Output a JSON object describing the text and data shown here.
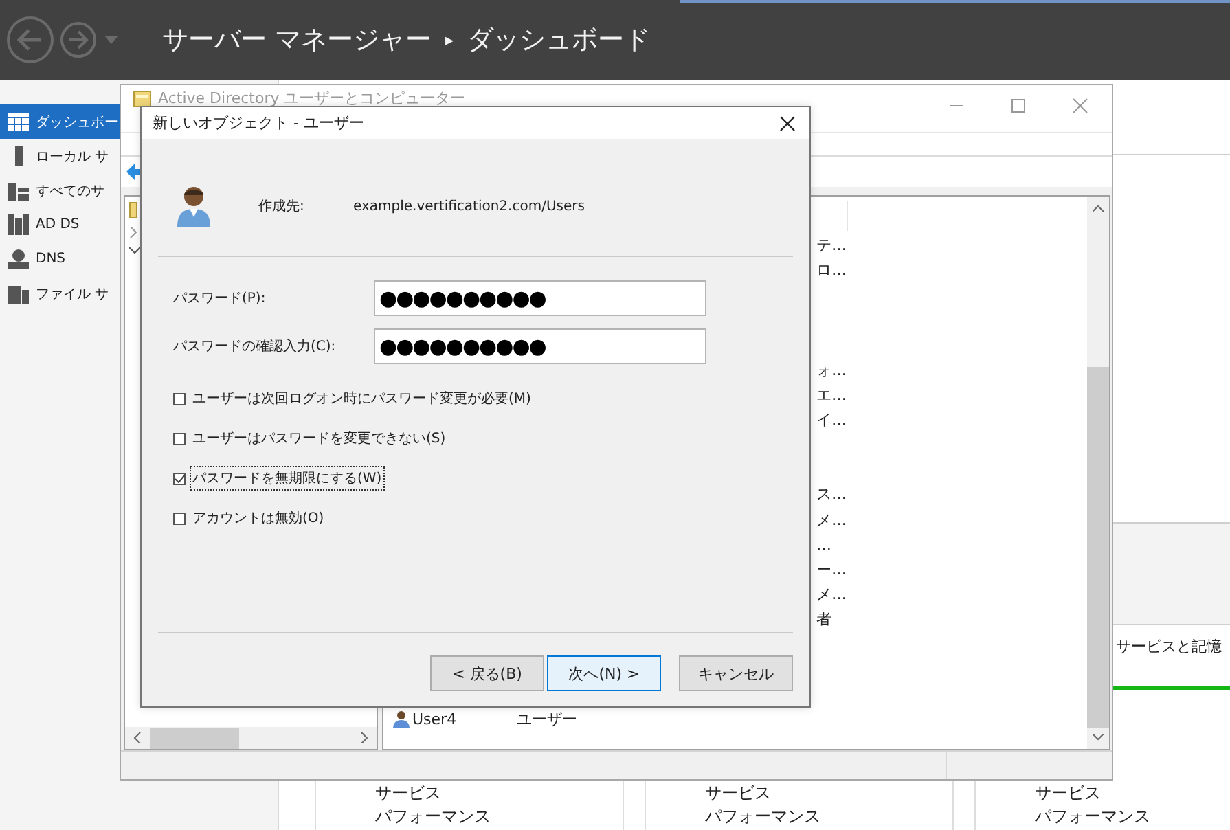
{
  "server_manager": {
    "breadcrumb": {
      "app": "サーバー マネージャー",
      "separator": "▸",
      "page": "ダッシュボード"
    },
    "sidebar": {
      "items": [
        {
          "label": "ダッシュボー",
          "selected": true
        },
        {
          "label": "ローカル サ",
          "selected": false
        },
        {
          "label": "すべてのサ",
          "selected": false
        },
        {
          "label": "AD DS",
          "selected": false
        },
        {
          "label": "DNS",
          "selected": false
        },
        {
          "label": "ファイル サ",
          "selected": false
        }
      ]
    },
    "tile_heading": "サービスと記憶",
    "tiles": [
      {
        "rows": [
          "サービス",
          "パフォーマンス"
        ]
      },
      {
        "rows": [
          "サービス",
          "パフォーマンス"
        ]
      },
      {
        "rows": [
          "サービス",
          "パフォーマンス"
        ]
      }
    ]
  },
  "aduc_window": {
    "title": "Active Directory ユーザーとコンピューター",
    "list": {
      "rows": [
        {
          "kind": "fragment",
          "description": "テ…"
        },
        {
          "kind": "fragment",
          "description": "ロ…"
        },
        {
          "kind": "blank"
        },
        {
          "kind": "blank"
        },
        {
          "kind": "blank"
        },
        {
          "kind": "fragment",
          "description": "ォ…"
        },
        {
          "kind": "fragment",
          "description": "エ…"
        },
        {
          "kind": "fragment",
          "description": "イ…"
        },
        {
          "kind": "blank"
        },
        {
          "kind": "blank"
        },
        {
          "kind": "fragment",
          "description": "ス…"
        },
        {
          "kind": "fragment",
          "description": "メ…"
        },
        {
          "kind": "fragment",
          "description": "…"
        },
        {
          "kind": "fragment",
          "description": "ー…"
        },
        {
          "kind": "fragment",
          "description": "メ…"
        },
        {
          "kind": "fragment",
          "description": "者"
        },
        {
          "kind": "blank"
        },
        {
          "kind": "blank"
        },
        {
          "kind": "blank"
        },
        {
          "kind": "user",
          "name": "User4",
          "type": "ユーザー"
        }
      ]
    }
  },
  "dialog": {
    "title": "新しいオブジェクト - ユーザー",
    "create_in_label": "作成先:",
    "create_in_path": "example.vertification2.com/Users",
    "fields": [
      {
        "label": "パスワード(P):",
        "value": "●●●●●●●●●●"
      },
      {
        "label": "パスワードの確認入力(C):",
        "value": "●●●●●●●●●●"
      }
    ],
    "options": [
      {
        "label": "ユーザーは次回ログオン時にパスワード変更が必要(M)",
        "checked": false,
        "focused": false
      },
      {
        "label": "ユーザーはパスワードを変更できない(S)",
        "checked": false,
        "focused": false
      },
      {
        "label": "パスワードを無期限にする(W)",
        "checked": true,
        "focused": true
      },
      {
        "label": "アカウントは無効(O)",
        "checked": false,
        "focused": false
      }
    ],
    "buttons": [
      {
        "label": "< 戻る(B)",
        "default": false
      },
      {
        "label": "次へ(N) >",
        "default": true
      },
      {
        "label": "キャンセル",
        "default": false
      }
    ]
  }
}
